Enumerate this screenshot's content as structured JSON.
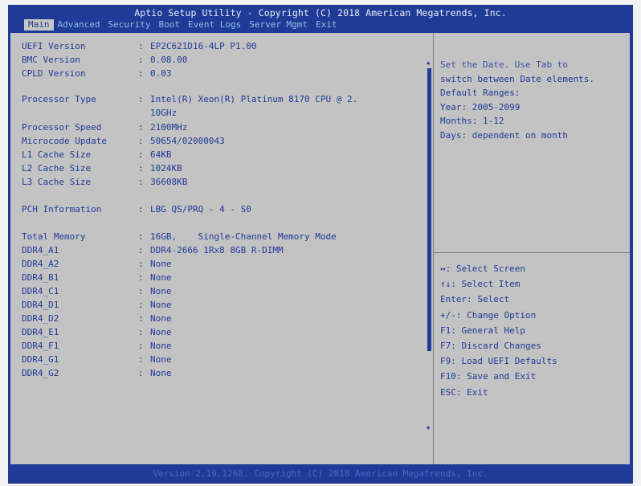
{
  "title": "Aptio Setup Utility - Copyright (C) 2018 American Megatrends, Inc.",
  "menu": [
    "Main",
    "Advanced",
    "Security",
    "Boot",
    "Event Logs",
    "Server Mgmt",
    "Exit"
  ],
  "active_menu": "Main",
  "info": [
    {
      "label": "UEFI Version",
      "value": "EP2C621D16-4LP P1.00"
    },
    {
      "label": "BMC Version",
      "value": "0.08.00"
    },
    {
      "label": "CPLD Version",
      "value": "0.03"
    },
    {
      "label": "Processor Type",
      "value": "Intel(R) Xeon(R) Platinum 8170 CPU @ 2.",
      "continuation": "10GHz"
    },
    {
      "label": "Processor Speed",
      "value": "2100MHz"
    },
    {
      "label": "Microcode Update",
      "value": "50654/02000043"
    },
    {
      "label": "L1 Cache Size",
      "value": "64KB"
    },
    {
      "label": "L2 Cache Size",
      "value": "1024KB"
    },
    {
      "label": "L3 Cache Size",
      "value": "36608KB"
    },
    {
      "label": "PCH Information",
      "value": "LBG QS/PRQ - 4 - S0"
    },
    {
      "label": "Total Memory",
      "value": "16GB,    Single-Channel Memory Mode"
    },
    {
      "label": "DDR4_A1",
      "value": "DDR4-2666 1Rx8 8GB R-DIMM"
    },
    {
      "label": "DDR4_A2",
      "value": "None"
    },
    {
      "label": "DDR4_B1",
      "value": "None"
    },
    {
      "label": "DDR4_C1",
      "value": "None"
    },
    {
      "label": "DDR4_D1",
      "value": "None"
    },
    {
      "label": "DDR4_D2",
      "value": "None"
    },
    {
      "label": "DDR4_E1",
      "value": "None"
    },
    {
      "label": "DDR4_F1",
      "value": "None"
    },
    {
      "label": "DDR4_G1",
      "value": "None"
    },
    {
      "label": "DDR4_G2",
      "value": "None"
    }
  ],
  "help": [
    "Set the Date. Use Tab to",
    "switch between Date elements.",
    "Default Ranges:",
    "Year: 2005-2099",
    "Months: 1-12",
    "Days: dependent on month"
  ],
  "keys": [
    "↔: Select Screen",
    "↑↓: Select Item",
    "Enter: Select",
    "+/-: Change Option",
    "F1: General Help",
    "F7: Discard Changes",
    "F9: Load UEFI Defaults",
    "F10: Save and Exit",
    "ESC: Exit"
  ],
  "footer": "Version 2.19.1268. Copyright (C) 2018 American Megatrends, Inc.",
  "scroll_up_glyph": "▲",
  "scroll_down_glyph": "▼",
  "colors": {
    "frame": "#1f3a97",
    "panel": "#c3c3c3",
    "text": "#1f3a97",
    "menu_inactive": "#8fbfe0",
    "footer_text": "#4b66c6"
  }
}
